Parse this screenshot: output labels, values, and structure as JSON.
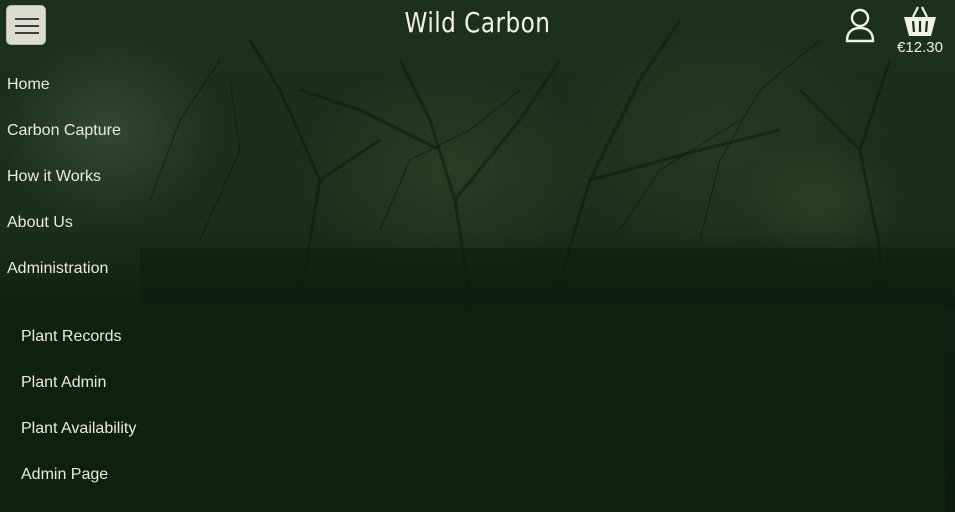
{
  "header": {
    "brand": "Wild Carbon",
    "basket_total": "€12.30",
    "menu_toggle": "menu-icon",
    "account_icon": "user-icon",
    "basket_icon": "basket-icon"
  },
  "nav": {
    "items": [
      {
        "label": "Home"
      },
      {
        "label": "Carbon Capture"
      },
      {
        "label": "How it Works"
      },
      {
        "label": "About Us"
      },
      {
        "label": "Administration"
      }
    ],
    "admin_submenu": [
      {
        "label": "Plant Records"
      },
      {
        "label": "Plant Admin"
      },
      {
        "label": "Plant Availability"
      },
      {
        "label": "Admin Page"
      }
    ]
  },
  "colors": {
    "text": "#ecebdc",
    "toggle_bg": "#dcdcd3",
    "overlay": "#0e2011"
  }
}
